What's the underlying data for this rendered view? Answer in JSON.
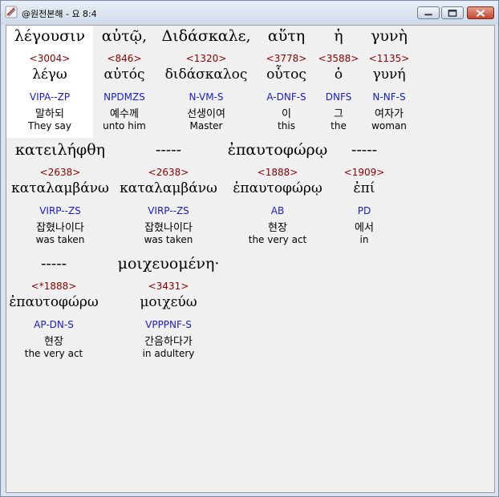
{
  "window": {
    "title": "@원전본해 - 요 8:4"
  },
  "colors": {
    "strongs": "#8b0000",
    "parsing": "#1a1acc",
    "text": "#000000",
    "selected_bg": "#ffffff"
  },
  "rows": [
    {
      "words": [
        {
          "greek": "λέγουσιν",
          "strongs": "<3004>",
          "lexical": "λέγω",
          "parsing": "VIPA--ZP",
          "korean": "말하되",
          "english": "They say",
          "selected": true
        },
        {
          "greek": "αὐτῷ,",
          "strongs": "<846>",
          "lexical": "αὐτός",
          "parsing": "NPDMZS",
          "korean": "예수께",
          "english": "unto him"
        },
        {
          "greek": "Διδάσκαλε,",
          "strongs": "<1320>",
          "lexical": "διδάσκαλος",
          "parsing": "N-VM-S",
          "korean": "선생이여",
          "english": "Master"
        },
        {
          "greek": "αὕτη",
          "strongs": "<3778>",
          "lexical": "οὗτος",
          "parsing": "A-DNF-S",
          "korean": "이",
          "english": "this"
        },
        {
          "greek": "ἡ",
          "strongs": "<3588>",
          "lexical": "ὁ",
          "parsing": "DNFS",
          "korean": "그",
          "english": "the"
        },
        {
          "greek": "γυνὴ",
          "strongs": "<1135>",
          "lexical": "γυνή",
          "parsing": "N-NF-S",
          "korean": "여자가",
          "english": "woman"
        }
      ]
    },
    {
      "words": [
        {
          "greek": "κατειλήφθη",
          "strongs": "<2638>",
          "lexical": "καταλαμβάνω",
          "parsing": "VIRP--ZS",
          "korean": "잡혔나이다",
          "english": "was taken"
        },
        {
          "greek": "-----",
          "strongs": "<2638>",
          "lexical": "καταλαμβάνω",
          "parsing": "VIRP--ZS",
          "korean": "잡혔나이다",
          "english": "was taken"
        },
        {
          "greek": "ἐπαυτοφώρῳ",
          "strongs": "<1888>",
          "lexical": "ἐπαυτοφώρῳ",
          "parsing": "AB",
          "korean": "현장",
          "english": "the very act"
        },
        {
          "greek": "-----",
          "strongs": "<1909>",
          "lexical": "ἐπί",
          "parsing": "PD",
          "korean": "에서",
          "english": "in"
        }
      ]
    },
    {
      "words": [
        {
          "greek": "-----",
          "strongs": "<*1888>",
          "lexical": "ἐπαυτοφώρω",
          "parsing": "AP-DN-S",
          "korean": "현장",
          "english": "the very act"
        },
        {
          "greek": "μοιχευομένη·",
          "strongs": "<3431>",
          "lexical": "μοιχεύω",
          "parsing": "VPPPNF-S",
          "korean": "간음하다가",
          "english": "in adultery"
        }
      ]
    }
  ]
}
